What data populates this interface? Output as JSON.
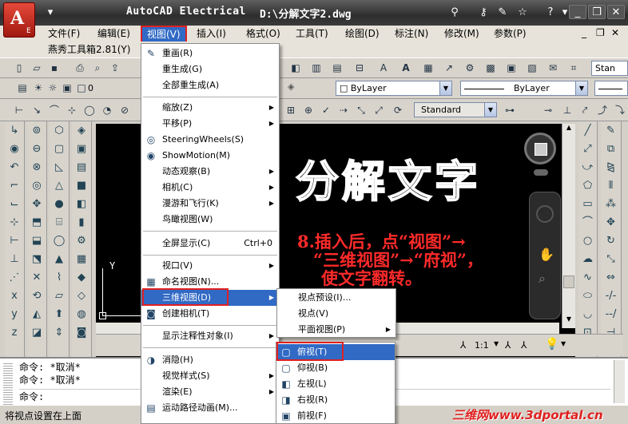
{
  "window": {
    "app_title": "AutoCAD Electrical",
    "file_path": "D:\\分解文字2.dwg",
    "logo_letter": "A",
    "logo_sub": "E"
  },
  "menubar": {
    "items": [
      "文件(F)",
      "编辑(E)",
      "视图(V)",
      "插入(I)",
      "格式(O)",
      "工具(T)",
      "绘图(D)",
      "标注(N)",
      "修改(M)",
      "参数(P)"
    ],
    "second_row": "燕秀工具箱2.81(Y)"
  },
  "toolbar": {
    "layer_value": "0",
    "linetype_left": "ByLayer",
    "linetype_right": "ByLayer",
    "text_style": "Standard",
    "dim_style_right": "Stan"
  },
  "view_menu": {
    "items": [
      {
        "label": "重画(R)",
        "icon": "pencil-icon"
      },
      {
        "label": "重生成(G)"
      },
      {
        "label": "全部重生成(A)"
      },
      {
        "label": "缩放(Z)",
        "submenu": true
      },
      {
        "label": "平移(P)",
        "submenu": true
      },
      {
        "label": "SteeringWheels(S)",
        "icon": "steering-wheel-icon"
      },
      {
        "label": "ShowMotion(M)",
        "icon": "showmotion-icon"
      },
      {
        "label": "动态观察(B)",
        "submenu": true
      },
      {
        "label": "相机(C)",
        "submenu": true
      },
      {
        "label": "漫游和飞行(K)",
        "submenu": true
      },
      {
        "label": "鸟瞰视图(W)"
      },
      {
        "label": "全屏显示(C)",
        "accel": "Ctrl+0"
      },
      {
        "label": "视口(V)",
        "submenu": true
      },
      {
        "label": "命名视图(N)...",
        "icon": "named-view-icon"
      },
      {
        "label": "三维视图(D)",
        "submenu": true,
        "highlighted": true
      },
      {
        "label": "创建相机(T)",
        "icon": "camera-icon"
      },
      {
        "label": "显示注释性对象(I)",
        "submenu": true
      },
      {
        "label": "消隐(H)",
        "icon": "hide-icon"
      },
      {
        "label": "视觉样式(S)",
        "submenu": true
      },
      {
        "label": "渲染(E)",
        "submenu": true
      },
      {
        "label": "运动路径动画(M)...",
        "icon": "motion-path-icon"
      }
    ]
  },
  "submenu_3d": {
    "items": [
      {
        "label": "视点预设(I)..."
      },
      {
        "label": "视点(V)"
      },
      {
        "label": "平面视图(P)",
        "submenu": true
      }
    ]
  },
  "submenu_views": {
    "items": [
      {
        "label": "俯视(T)",
        "highlighted": true
      },
      {
        "label": "仰视(B)"
      },
      {
        "label": "左视(L)"
      },
      {
        "label": "右视(R)"
      },
      {
        "label": "前视(F)"
      }
    ]
  },
  "canvas": {
    "big_text": "分解文字",
    "annotation_line1": "8.插入后，点“视图”→",
    "annotation_line2": "“三维视图”→“府视”，",
    "annotation_line3": "使文字翻转。",
    "ucs_label": "Y",
    "scale_label": "1:1"
  },
  "command_line": {
    "lines": [
      "命令: *取消*",
      "命令: *取消*",
      "命令:"
    ]
  },
  "status_bar": {
    "text": "将视点设置在上面"
  },
  "watermark": "三维网www.3dportal.cn"
}
